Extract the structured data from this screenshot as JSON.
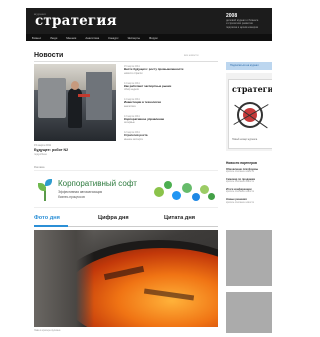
{
  "header": {
    "logo_kicker": "журнал",
    "logo": "стратегия",
    "year": "2008",
    "info_lines": [
      "деловой журнал о бизнесе",
      "и стратегиях развития",
      "подписка и архив номеров"
    ]
  },
  "nav": {
    "items": [
      "Бизнес",
      "Люди",
      "Мнения",
      "Аналитика",
      "Конкурс",
      "Эксперты",
      "Форум"
    ]
  },
  "news": {
    "title": "Новости",
    "more_label": "все новости",
    "featured": {
      "date": "15 марта 2011",
      "title": "Будущее: робот N2",
      "more": "подробнее"
    },
    "items": [
      {
        "date": "15 марта 2011",
        "title": "Вести будущего: росту промышленности",
        "text": "новости отрасли"
      },
      {
        "date": "14 марта 2011",
        "title": "Как работают экспортные рынки",
        "text": "обзор недели"
      },
      {
        "date": "14 марта 2011",
        "title": "Инвестиции в технологии",
        "text": "аналитика"
      },
      {
        "date": "13 марта 2011",
        "title": "Корпоративное управление",
        "text": "интервью"
      },
      {
        "date": "12 марта 2011",
        "title": "Стратегия роста",
        "text": "мнение эксперта"
      }
    ]
  },
  "ad": {
    "label": "Реклама",
    "title": "Корпоративный софт",
    "sub1": "Эффективная автоматизация",
    "sub2": "бизнес-процессов"
  },
  "tabs": {
    "items": [
      "Фото дня",
      "Цифра дня",
      "Цитата дня"
    ]
  },
  "photo_of_day": {
    "caption": "Лава в кратере вулкана"
  },
  "sidebar": {
    "subscribe_label": "Подписаться на журнал",
    "magazine": {
      "logo": "стратегия",
      "text": "Новый номер журнала"
    },
    "partners": {
      "title": "Новости партнеров",
      "items": [
        {
          "title": "Обновление платформы",
          "text": "краткое описание новости"
        },
        {
          "title": "Семинар по продажам",
          "text": "краткое описание новости"
        },
        {
          "title": "Итоги конференции",
          "text": "краткое описание новости"
        },
        {
          "title": "Новые решения",
          "text": "краткое описание новости"
        }
      ]
    }
  },
  "colors": {
    "header_bg": "#1c1c1c",
    "accent": "#2b8fd6",
    "ad_green": "#2c7a3d",
    "placeholder_gray": "#ababab"
  }
}
